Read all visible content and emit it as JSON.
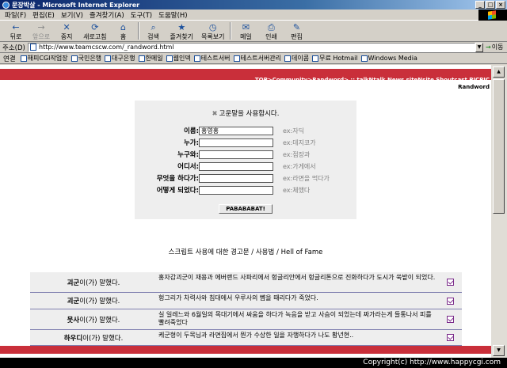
{
  "window": {
    "title": "문장박살 - Microsoft Internet Explorer",
    "btn_min": "_",
    "btn_max": "□",
    "btn_close": "×"
  },
  "menu": [
    "파일(F)",
    "편집(E)",
    "보기(V)",
    "즐겨찾기(A)",
    "도구(T)",
    "도움말(H)"
  ],
  "toolbar": [
    {
      "icon": "←",
      "label": "뒤로"
    },
    {
      "icon": "→",
      "label": "앞으로"
    },
    {
      "icon": "✕",
      "label": "중지"
    },
    {
      "icon": "⟳",
      "label": "새로고침"
    },
    {
      "icon": "⌂",
      "label": "홈"
    },
    {
      "icon": "⌕",
      "label": "검색"
    },
    {
      "icon": "★",
      "label": "즐겨찾기"
    },
    {
      "icon": "◷",
      "label": "목록보기"
    },
    {
      "icon": "✉",
      "label": "메일"
    },
    {
      "icon": "⎙",
      "label": "인쇄"
    },
    {
      "icon": "✎",
      "label": "편집"
    }
  ],
  "address": {
    "label": "주소(D)",
    "url": "http://www.teamcscw.com/_randword.html",
    "go_label": "이동"
  },
  "links": {
    "title": "연결",
    "items": [
      "해피CGI작업장",
      "국민은행",
      "대구은행",
      "한메일",
      "웹인덱",
      "테스트서버",
      "테스트서버관리",
      "데이콤",
      "무료 Hotmail",
      "Windows Media"
    ]
  },
  "site": {
    "nav": "TOP>Community>Randword> :: talkNtalk  News  siteNsite  Shoutcast  PICPIC",
    "nav_sub": "Randword"
  },
  "form": {
    "title": "고운말을 사용합시다.",
    "fields": [
      {
        "label": "이름:",
        "value": "홍영홍",
        "example": "ex:자딕"
      },
      {
        "label": "누가:",
        "value": "",
        "example": "ex:데지코가"
      },
      {
        "label": "누구와:",
        "value": "",
        "example": "ex:점장과"
      },
      {
        "label": "어디서:",
        "value": "",
        "example": "ex:가게에서"
      },
      {
        "label": "무엇을 하다가:",
        "value": "",
        "example": "ex:라면을 먹다가"
      },
      {
        "label": "어떻게 되었다:",
        "value": "",
        "example": "ex:체했다"
      }
    ],
    "submit_label": "PABABABAT!"
  },
  "links_line": "스크립트 사용에 대한 경고문 / 사용법 / Hell of Fame",
  "entries": [
    {
      "name": "괴군",
      "suffix": "이(가) 말했다.",
      "msg": "홍자감괴군이 재용과 에버랜드 사파리에서 헝글리안에서 헝글리톤으로 진화하다가 도시가 쑥밭이 되었다."
    },
    {
      "name": "괴군",
      "suffix": "이(가) 말했다.",
      "msg": "헝그리가 차력사와 침대에서 우루사의 뺨을 때리다가 죽었다."
    },
    {
      "name": "뭇사",
      "suffix": "이(가) 말했다.",
      "msg": "실 일레느와 6월일의 목대기에서 싸움을 하다가 녹음을 받고 사슴이 되었는데 짜가라는게 들통나서 피를 빨려죽었다"
    },
    {
      "name": "하우디",
      "suffix": "이(가) 말했다.",
      "msg": "케군형이 두목님과 라면집에서 뭔가 수상한 일을 자행하다가 나도 황년현.."
    }
  ],
  "copyright": "Copyright(c) http://www.happycgi.com"
}
